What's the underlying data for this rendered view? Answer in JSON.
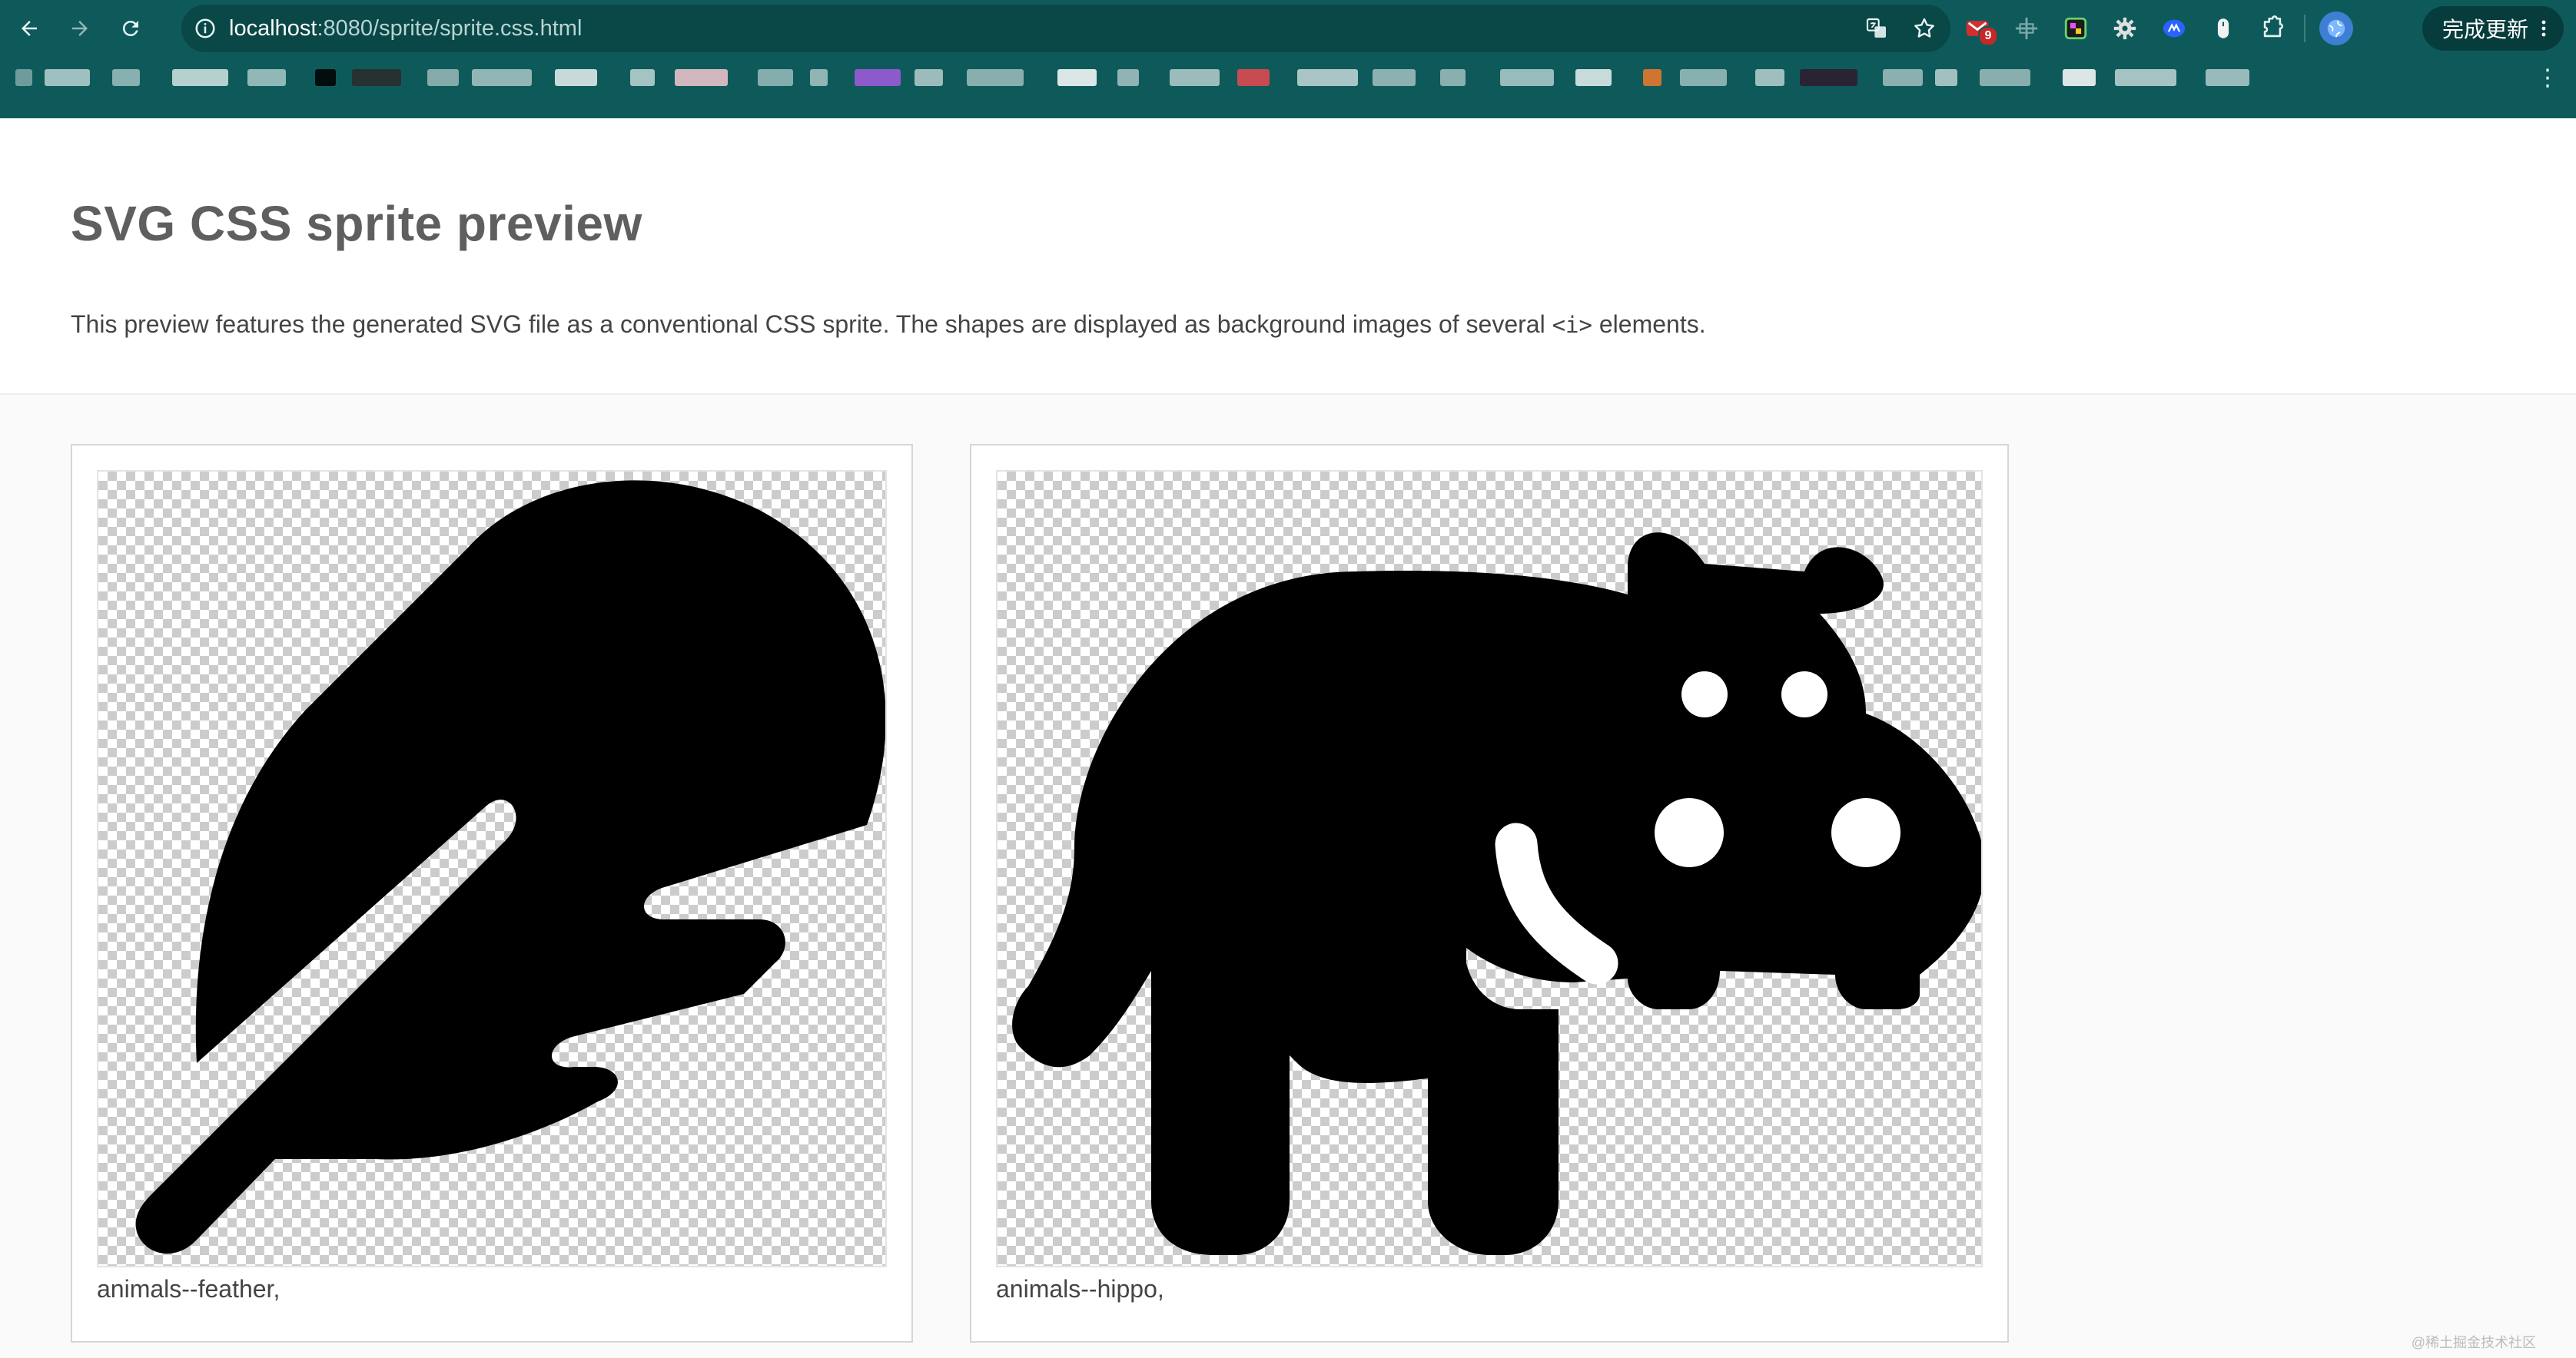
{
  "browser": {
    "url_host": "localhost",
    "url_path": ":8080/sprite/sprite.css.html",
    "update_label": "完成更新",
    "extension_badge": "9",
    "bookmark_colors": [
      "#7fa8a8",
      "#b9d2d2",
      "#9fc0c0",
      "#d3e4e4",
      "#a8c8c8",
      "#000000",
      "#2a2a2a",
      "#9ab8b8",
      "#a9c6c6",
      "#e8f0f0",
      "#c0d6d6",
      "#f4c8d0",
      "#9bbcbc",
      "#a8c4c4",
      "#a35be0",
      "#b5cccc",
      "#9ebdbd",
      "#ffffff",
      "#a9c3c3",
      "#b5cece",
      "#e8494f",
      "#c4d8d8",
      "#a3c0c0",
      "#a0bebe",
      "#b0cccc",
      "#e9f2f2",
      "#f07a2a",
      "#9fbfbf",
      "#b9d0d0",
      "#2e1a2e",
      "#a2bebe",
      "#bcd2d2",
      "#9fbdbd",
      "#ffffff",
      "#c1d6d6",
      "#b2cbcb"
    ]
  },
  "page": {
    "title": "SVG CSS sprite preview",
    "description_before": "This preview features the generated SVG file as a conventional CSS sprite. The shapes are displayed as background images of several ",
    "description_code": "<i>",
    "description_after": " elements."
  },
  "sprites": [
    {
      "name": "animals--feather,",
      "icon": "feather-icon"
    },
    {
      "name": "animals--hippo,",
      "icon": "hippo-icon"
    }
  ],
  "watermark": "@稀土掘金技术社区"
}
